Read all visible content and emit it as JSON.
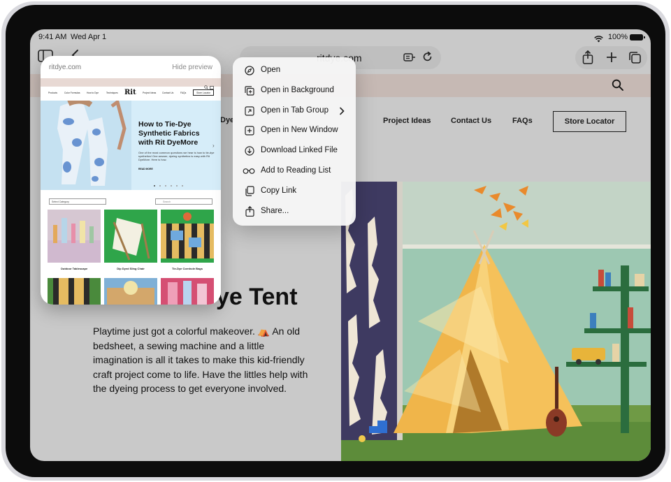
{
  "status_bar": {
    "time": "9:41 AM",
    "date": "Wed Apr 1",
    "battery": "100%"
  },
  "toolbar": {
    "url": "ritdye.com"
  },
  "site": {
    "nav": {
      "partial_link": "Dye",
      "project_ideas": "Project Ideas",
      "contact_us": "Contact Us",
      "faqs": "FAQs",
      "store_locator": "Store Locator"
    },
    "article": {
      "title_fragment": "ye Tent",
      "body": "Playtime just got a colorful makeover. ⛺ An old bedsheet, a sewing machine and a little imagination is all it takes to make this kid-friendly craft project come to life. Have the littles help with the dyeing process to get everyone involved."
    }
  },
  "preview": {
    "domain": "ritdye.com",
    "hide_label": "Hide preview",
    "nav": [
      "Products",
      "Color Formulas",
      "How to Dye",
      "Techniques",
      "Project Ideas",
      "Contact Us",
      "FAQs"
    ],
    "logo": "Rit",
    "store_locator": "Store Locator",
    "hero_title": "How to Tie-Dye Synthetic Fabrics with Rit DyeMore",
    "hero_text": "One of the most common questions we hear is how to tie-dye synthetics! One answer, dyeing synthetics is easy with Rit DyeMore. Here is how.",
    "read_more": "READ MORE",
    "select_label": "Select Category",
    "search_placeholder": "Search",
    "cards": [
      "Outdoor Tablescape",
      "Dip Dyed Sling Chair",
      "Tie-Dye Cornhole Bags"
    ]
  },
  "context_menu": {
    "items": [
      {
        "label": "Open",
        "icon": "compass-icon"
      },
      {
        "label": "Open in Background",
        "icon": "open-background-icon"
      },
      {
        "label": "Open in Tab Group",
        "icon": "tab-group-icon",
        "submenu": true
      },
      {
        "label": "Open in New Window",
        "icon": "new-window-icon"
      },
      {
        "label": "Download Linked File",
        "icon": "download-icon"
      },
      {
        "label": "Add to Reading List",
        "icon": "glasses-icon"
      },
      {
        "label": "Copy Link",
        "icon": "copy-icon"
      },
      {
        "label": "Share...",
        "icon": "share-icon"
      }
    ]
  }
}
